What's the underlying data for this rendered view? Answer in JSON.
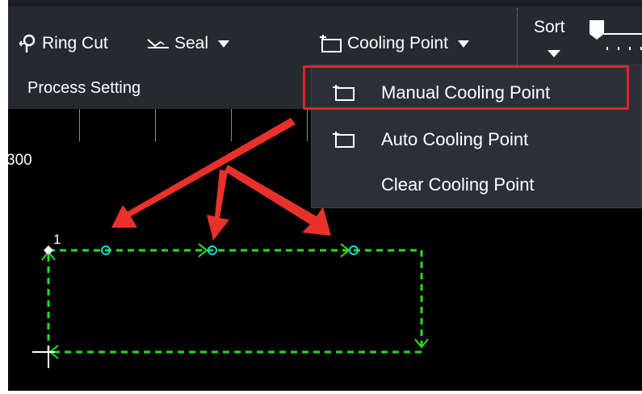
{
  "toolbar": {
    "ring_cut_label": "Ring Cut",
    "seal_label": "Seal",
    "cooling_point_label": "Cooling Point",
    "sort_label": "Sort",
    "process_setting_label": "Process Setting"
  },
  "dropdown": {
    "items": [
      {
        "label": "Manual Cooling Point",
        "icon": "cooling-point-icon"
      },
      {
        "label": "Auto Cooling Point",
        "icon": "cooling-point-icon"
      },
      {
        "label": "Clear Cooling Point",
        "icon": ""
      }
    ]
  },
  "ruler": {
    "label": "300"
  },
  "canvas": {
    "start_point_label": "1"
  },
  "colors": {
    "toolbar_bg": "#252a31",
    "canvas_bg": "#000000",
    "path_green": "#22e01a",
    "cooling_point_cyan": "#19d7d7",
    "highlight_red": "#e8212a",
    "arrow_red": "#e8312a"
  }
}
